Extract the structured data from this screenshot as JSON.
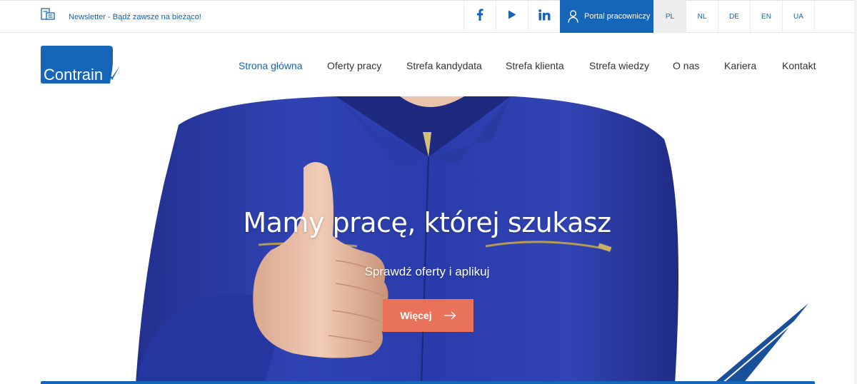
{
  "topbar": {
    "newsletter_label": "Newsletter - Bądź zawsze na bieżąco!",
    "portal_label": "Portal pracowniczy",
    "languages": [
      "PL",
      "NL",
      "DE",
      "EN",
      "UA"
    ],
    "active_language": "PL"
  },
  "logo": {
    "text": "Contrain"
  },
  "nav": {
    "items": [
      "Strona główna",
      "Oferty pracy",
      "Strefa kandydata",
      "Strefa klienta",
      "Strefa wiedzy",
      "O nas",
      "Kariera",
      "Kontakt"
    ],
    "active": "Strona główna"
  },
  "hero": {
    "title": "Mamy pracę, której szukasz",
    "subtitle": "Sprawdź oferty i aplikuj",
    "cta_label": "Więcej"
  },
  "colors": {
    "brand_blue": "#1565b8",
    "cta": "#e8735a",
    "jacket": "#2a3aa8"
  },
  "icons": [
    "newsletter-icon",
    "facebook-icon",
    "youtube-icon",
    "linkedin-icon",
    "user-icon",
    "arrow-right-icon"
  ]
}
